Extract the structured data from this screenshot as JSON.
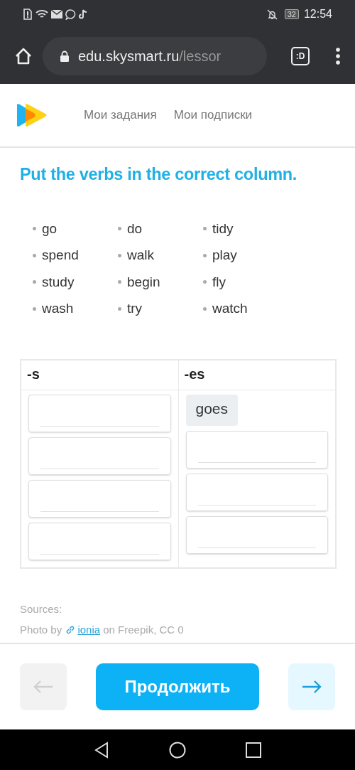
{
  "status_bar": {
    "time": "12:54",
    "battery": "32"
  },
  "browser": {
    "url_host": "edu.skysmart.ru",
    "url_path": "/lessor",
    "tab_badge": ":D"
  },
  "nav": {
    "links": [
      "Мои задания",
      "Мои подписки"
    ]
  },
  "task": {
    "title": "Put the verbs in the correct column.",
    "word_columns": [
      [
        "go",
        "spend",
        "study",
        "wash"
      ],
      [
        "do",
        "walk",
        "begin",
        "try"
      ],
      [
        "tidy",
        "play",
        "fly",
        "watch"
      ]
    ],
    "table": {
      "columns": [
        {
          "heading": "-s",
          "slots": [
            {
              "kind": "blank"
            },
            {
              "kind": "blank"
            },
            {
              "kind": "blank"
            },
            {
              "kind": "blank"
            }
          ]
        },
        {
          "heading": "-es",
          "slots": [
            {
              "kind": "answer",
              "text": "goes"
            },
            {
              "kind": "blank"
            },
            {
              "kind": "blank"
            },
            {
              "kind": "blank"
            }
          ]
        }
      ]
    }
  },
  "sources": {
    "label": "Sources:",
    "before": "Photo by",
    "link": "ionia",
    "after": "on Freepik, CC 0"
  },
  "footer": {
    "prev_disabled": true,
    "continue": "Продолжить",
    "next_disabled": false
  }
}
